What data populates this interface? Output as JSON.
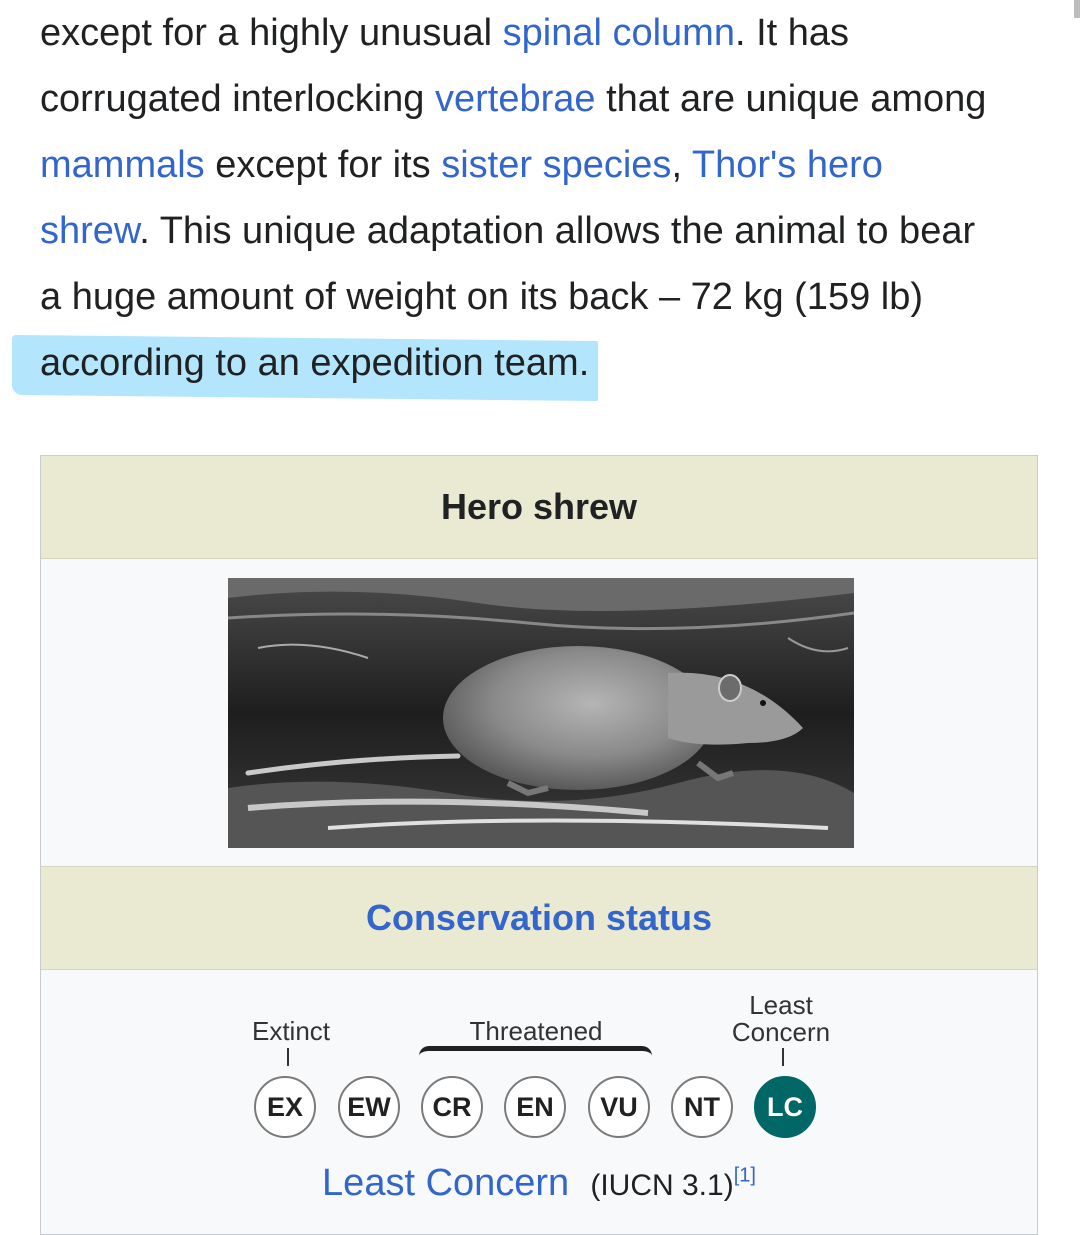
{
  "article": {
    "lines": [
      [
        {
          "t": "except for a highly unusual "
        },
        {
          "t": "spinal column",
          "link": true
        },
        {
          "t": ". It has"
        }
      ],
      [
        {
          "t": "corrugated interlocking "
        },
        {
          "t": "vertebrae",
          "link": true
        },
        {
          "t": " that are unique among"
        }
      ],
      [
        {
          "t": "mammals",
          "link": true
        },
        {
          "t": " except for its "
        },
        {
          "t": "sister species",
          "link": true
        },
        {
          "t": ", "
        },
        {
          "t": "Thor's hero",
          "link": true
        }
      ],
      [
        {
          "t": "shrew",
          "link": true
        },
        {
          "t": ". This unique adaptation allows the animal to bear"
        }
      ],
      [
        {
          "t": "a huge amount of weight on its back – 72 kg (159 lb)"
        }
      ],
      [
        {
          "t": "according to an expedition team",
          "highlight": true
        },
        {
          "t": "."
        }
      ]
    ],
    "highlight_color": "#b3e5fc"
  },
  "infobox": {
    "title": "Hero shrew",
    "image_alt": "Hero shrew photograph",
    "conservation_header": "Conservation status",
    "scale": {
      "extinct_label": "Extinct",
      "threatened_label": "Threatened",
      "least_concern_label_1": "Least",
      "least_concern_label_2": "Concern",
      "categories": [
        "EX",
        "EW",
        "CR",
        "EN",
        "VU",
        "NT",
        "LC"
      ],
      "active": "LC",
      "active_color": "#006666"
    },
    "status": {
      "name": "Least Concern",
      "source": "(IUCN 3.1)",
      "ref": "[1]"
    }
  },
  "colors": {
    "link": "#3366cc",
    "header_bg": "#eaead3",
    "box_bg": "#f8f9fa"
  }
}
